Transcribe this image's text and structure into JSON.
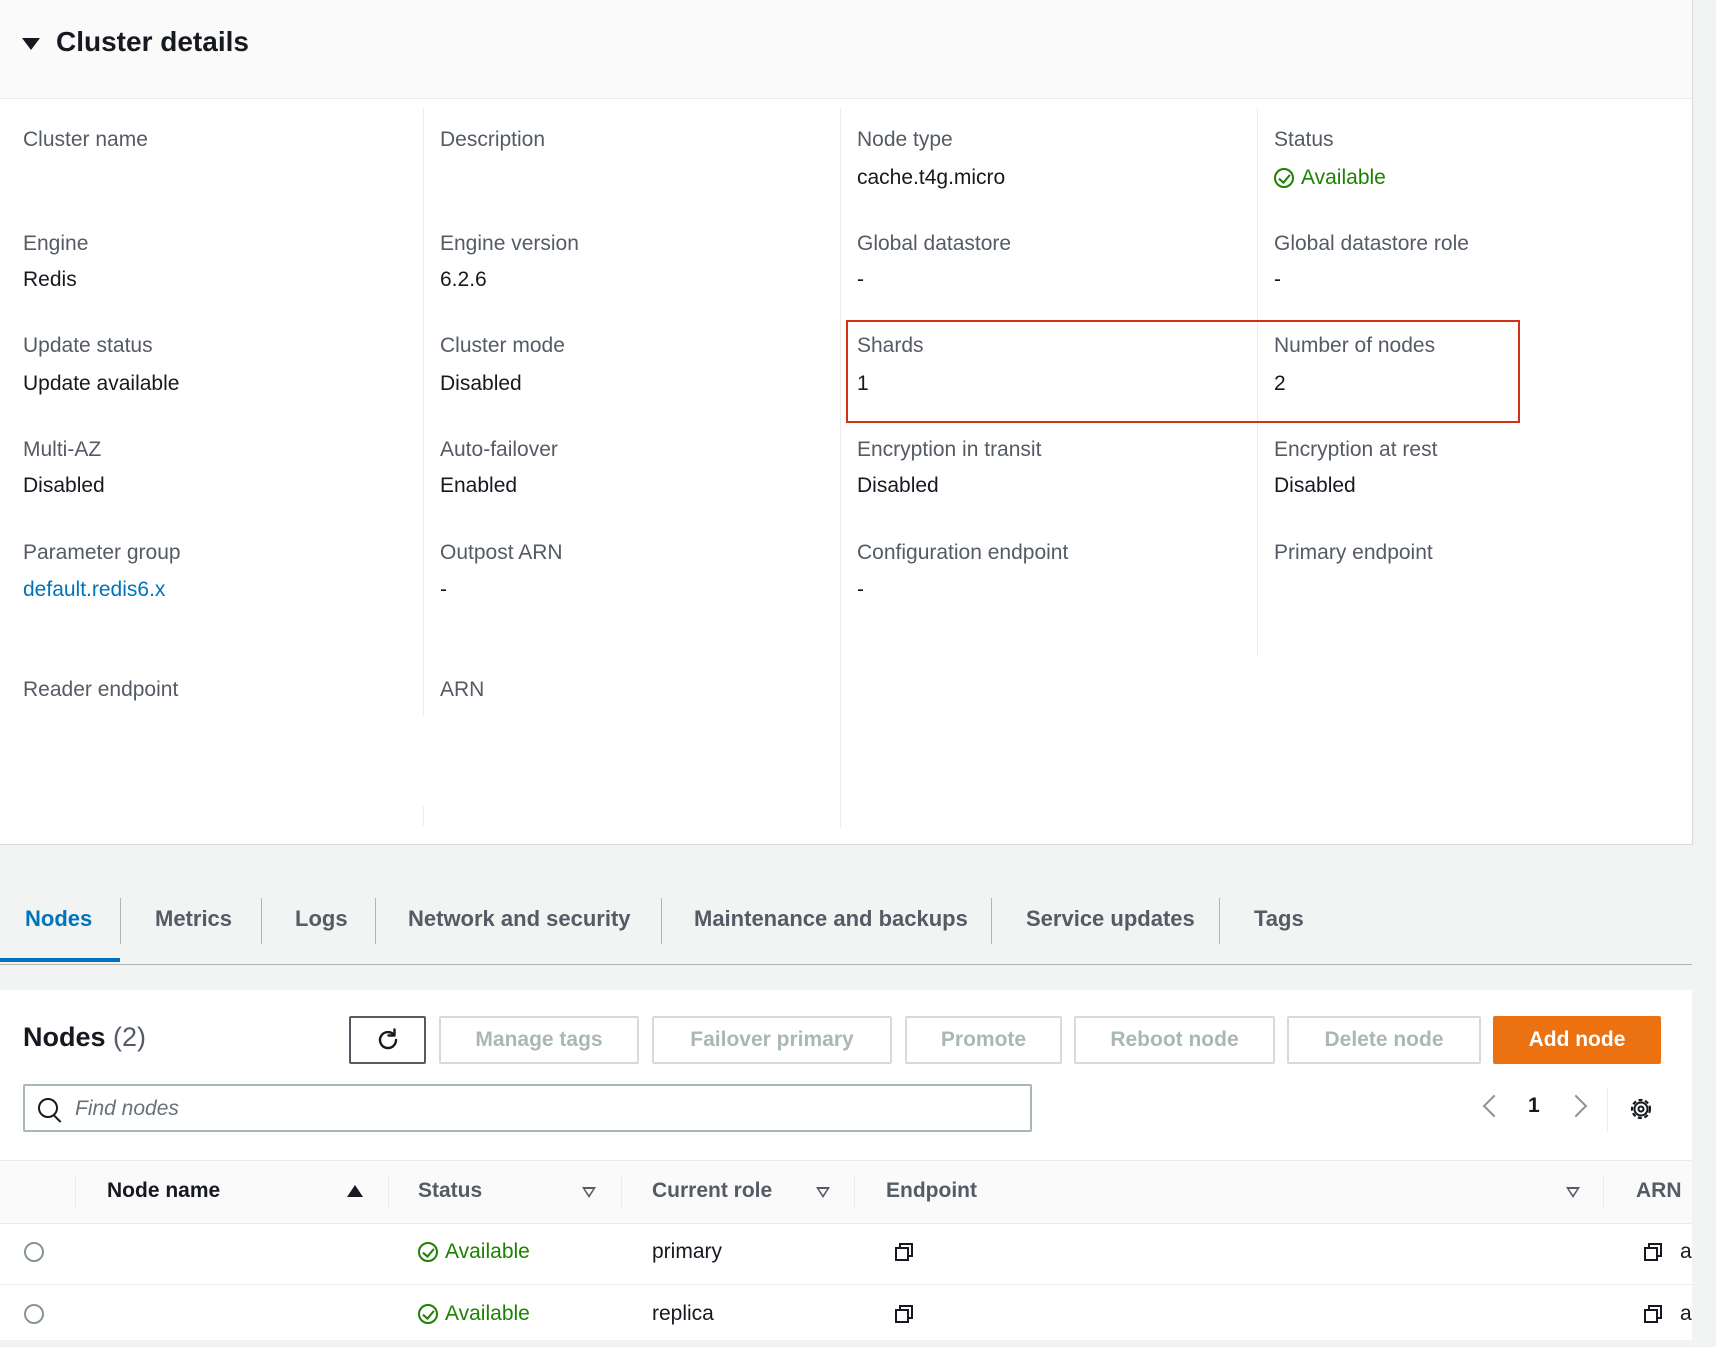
{
  "cluster_details": {
    "title": "Cluster details",
    "fields": {
      "cluster_name": {
        "label": "Cluster name",
        "value": ""
      },
      "description": {
        "label": "Description",
        "value": ""
      },
      "node_type": {
        "label": "Node type",
        "value": "cache.t4g.micro"
      },
      "status": {
        "label": "Status",
        "value": "Available"
      },
      "engine": {
        "label": "Engine",
        "value": "Redis"
      },
      "engine_version": {
        "label": "Engine version",
        "value": "6.2.6"
      },
      "global_datastore": {
        "label": "Global datastore",
        "value": "-"
      },
      "global_datastore_role": {
        "label": "Global datastore role",
        "value": "-"
      },
      "update_status": {
        "label": "Update status",
        "value": "Update available"
      },
      "cluster_mode": {
        "label": "Cluster mode",
        "value": "Disabled"
      },
      "shards": {
        "label": "Shards",
        "value": "1"
      },
      "number_of_nodes": {
        "label": "Number of nodes",
        "value": "2"
      },
      "multi_az": {
        "label": "Multi-AZ",
        "value": "Disabled"
      },
      "auto_failover": {
        "label": "Auto-failover",
        "value": "Enabled"
      },
      "encryption_in_transit": {
        "label": "Encryption in transit",
        "value": "Disabled"
      },
      "encryption_at_rest": {
        "label": "Encryption at rest",
        "value": "Disabled"
      },
      "parameter_group": {
        "label": "Parameter group",
        "value": "default.redis6.x"
      },
      "outpost_arn": {
        "label": "Outpost ARN",
        "value": "-"
      },
      "configuration_endpoint": {
        "label": "Configuration endpoint",
        "value": "-"
      },
      "primary_endpoint": {
        "label": "Primary endpoint",
        "value": ""
      },
      "reader_endpoint": {
        "label": "Reader endpoint",
        "value": ""
      },
      "arn": {
        "label": "ARN",
        "value": ""
      }
    }
  },
  "tabs": [
    "Nodes",
    "Metrics",
    "Logs",
    "Network and security",
    "Maintenance and backups",
    "Service updates",
    "Tags"
  ],
  "nodes": {
    "title": "Nodes",
    "count": "(2)",
    "buttons": {
      "manage_tags": "Manage tags",
      "failover_primary": "Failover primary",
      "promote": "Promote",
      "reboot_node": "Reboot node",
      "delete_node": "Delete node",
      "add_node": "Add node"
    },
    "search_placeholder": "Find nodes",
    "page": "1",
    "columns": [
      "Node name",
      "Status",
      "Current role",
      "Endpoint",
      "ARN"
    ],
    "rows": [
      {
        "node_name": "",
        "status": "Available",
        "role": "primary",
        "arn": "a"
      },
      {
        "node_name": "",
        "status": "Available",
        "role": "replica",
        "arn": "a"
      }
    ]
  },
  "colors": {
    "accent": "#0073bb",
    "success": "#1d8102",
    "primary_button": "#ec7211",
    "highlight": "#d13212"
  },
  "icons": [
    "caret-down-icon",
    "check-circle-icon",
    "refresh-icon",
    "search-icon",
    "chevron-left-icon",
    "chevron-right-icon",
    "gear-icon",
    "sort-asc-icon",
    "sort-desc-icon",
    "copy-icon"
  ]
}
